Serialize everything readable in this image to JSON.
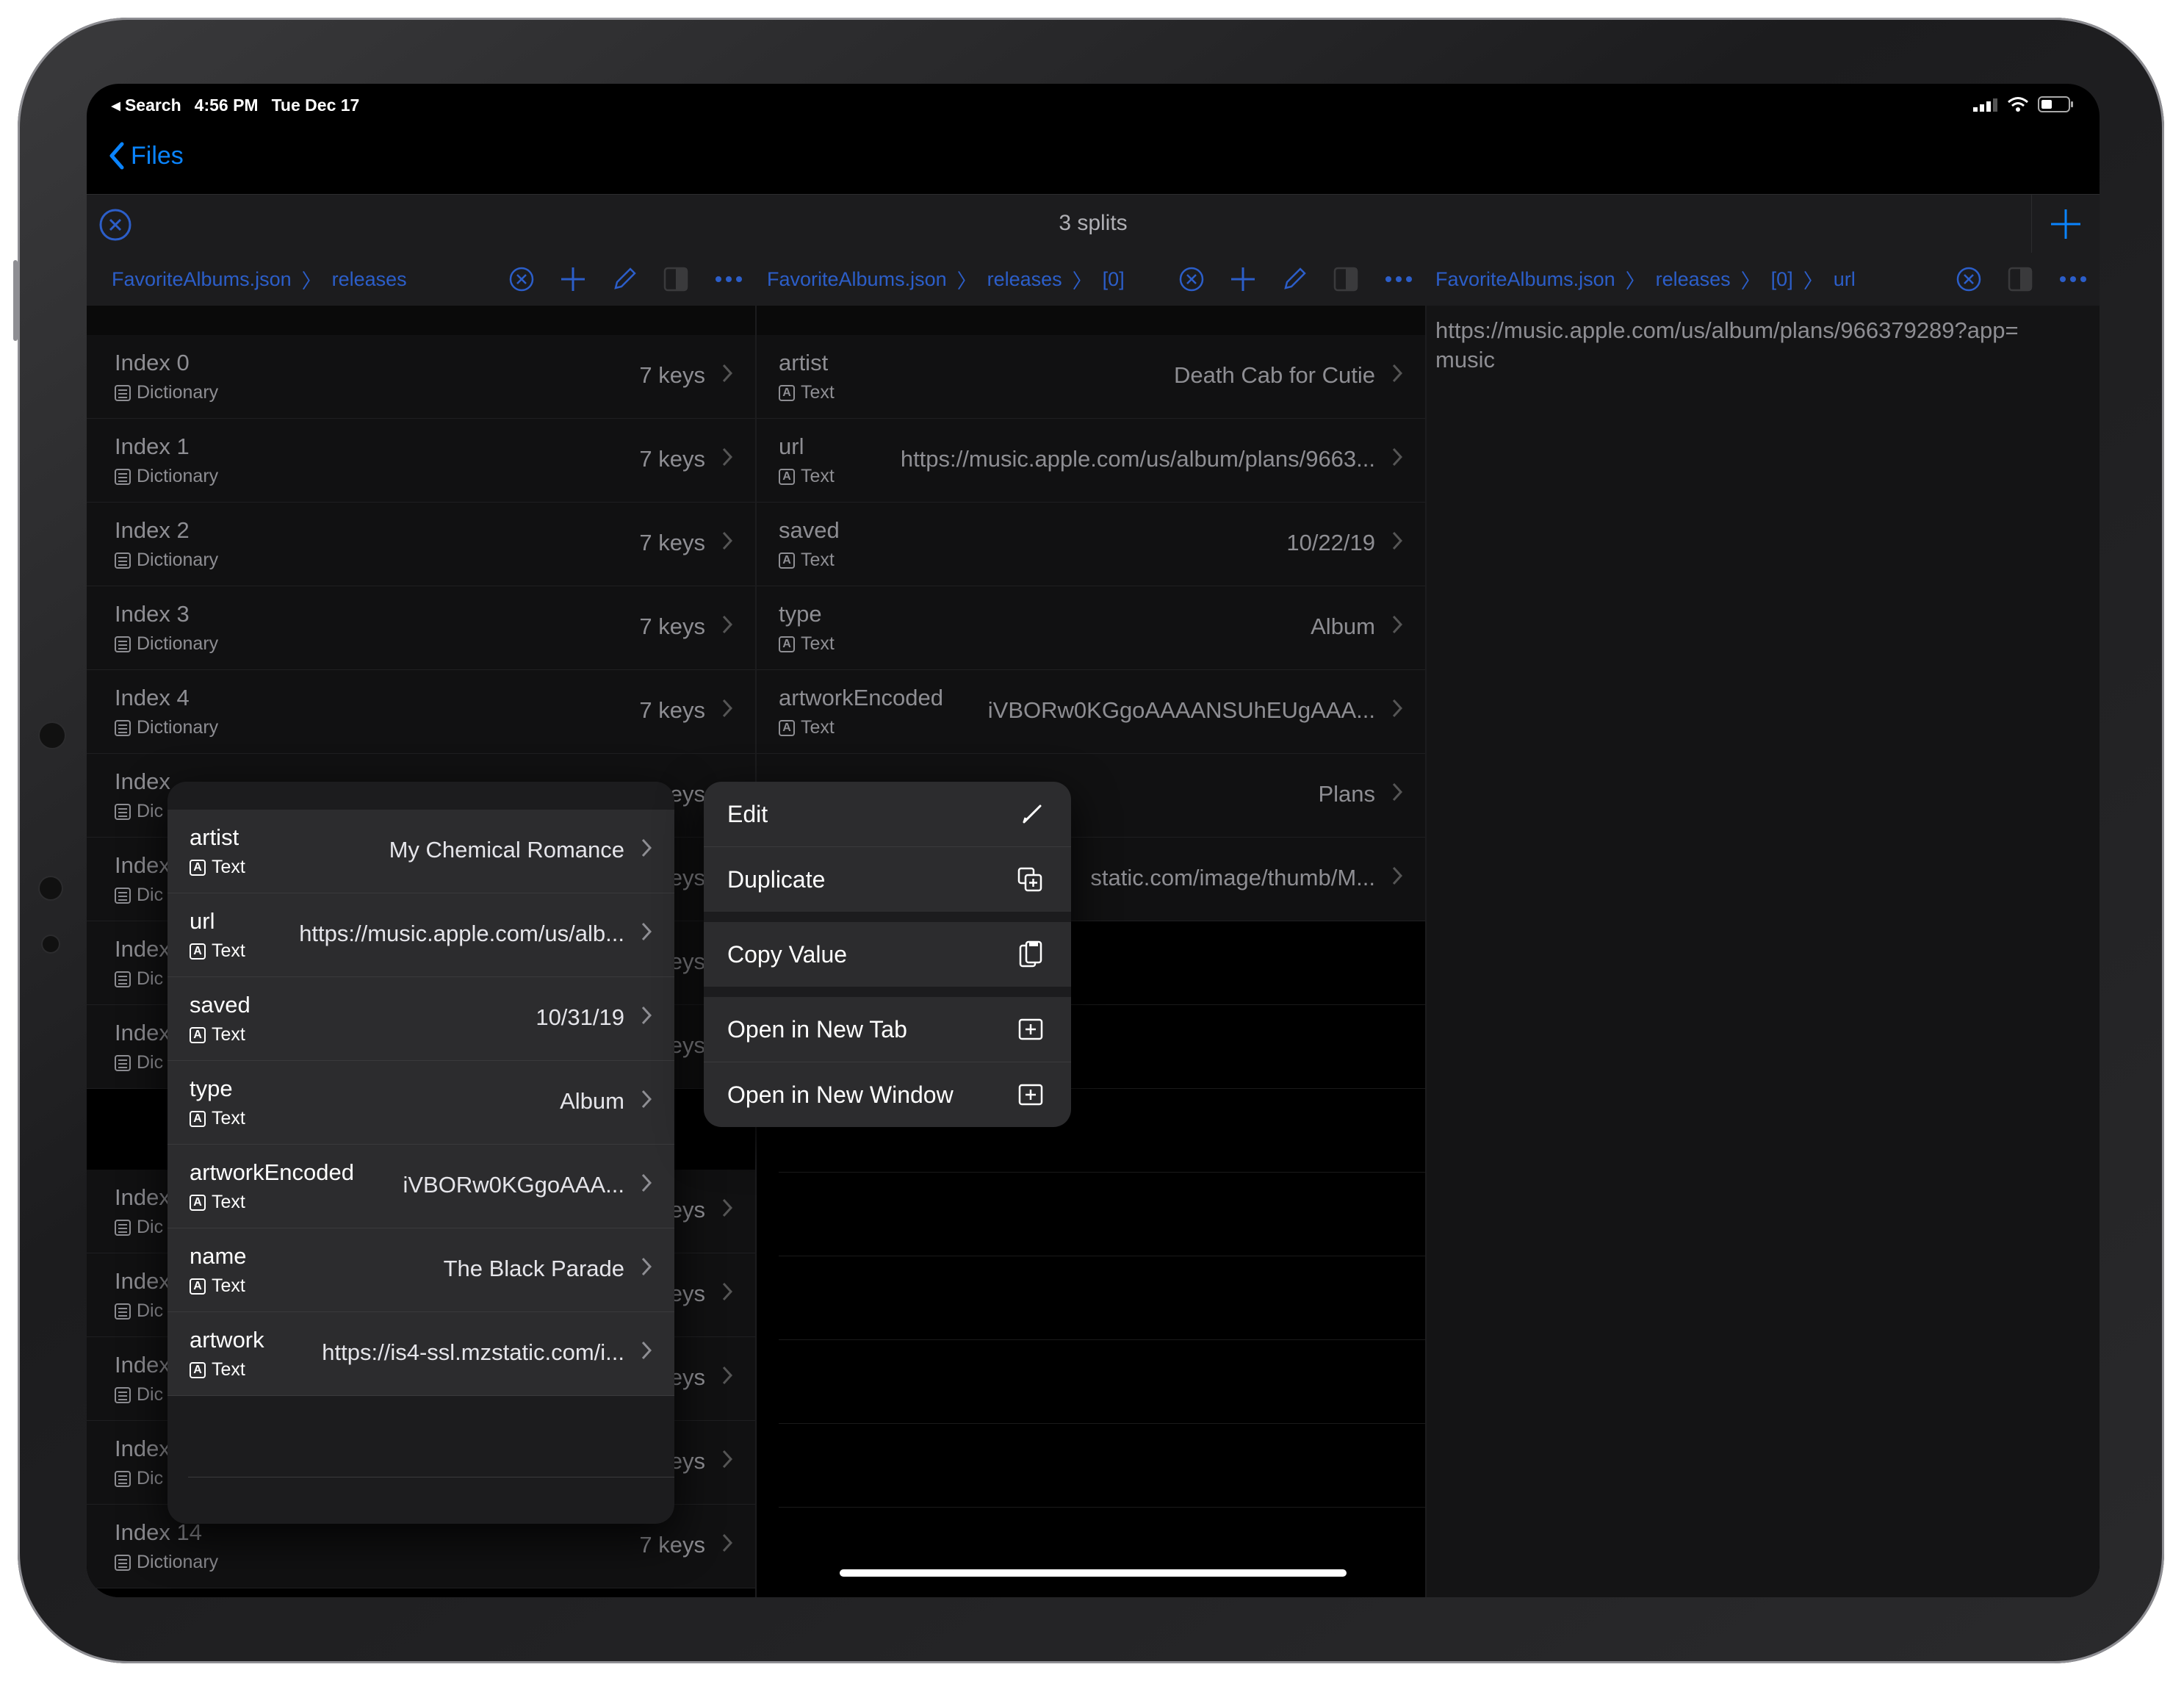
{
  "status": {
    "back_app": "Search",
    "time": "4:56 PM",
    "date": "Tue Dec 17"
  },
  "nav": {
    "back_label": "Files"
  },
  "tabbar": {
    "title": "3 splits"
  },
  "pane1": {
    "crumbs": [
      "FavoriteAlbums.json",
      "releases"
    ],
    "rows_top": [
      {
        "key": "Index 0",
        "type": "Dictionary",
        "value": "7 keys"
      },
      {
        "key": "Index 1",
        "type": "Dictionary",
        "value": "7 keys"
      },
      {
        "key": "Index 2",
        "type": "Dictionary",
        "value": "7 keys"
      },
      {
        "key": "Index 3",
        "type": "Dictionary",
        "value": "7 keys"
      },
      {
        "key": "Index 4",
        "type": "Dictionary",
        "value": "7 keys"
      },
      {
        "key": "Index",
        "type": "Dic",
        "value": "eys"
      },
      {
        "key": "Index",
        "type": "Dic",
        "value": "eys"
      },
      {
        "key": "Index",
        "type": "Dic",
        "value": "eys"
      },
      {
        "key": "Index",
        "type": "Dic",
        "value": "eys"
      }
    ],
    "rows_bottom": [
      {
        "key": "Index",
        "type": "Dic",
        "value": "eys"
      },
      {
        "key": "Index",
        "type": "Dic",
        "value": "eys"
      },
      {
        "key": "Index",
        "type": "Dic",
        "value": "eys"
      },
      {
        "key": "Index",
        "type": "Dic",
        "value": "eys"
      },
      {
        "key": "Index 14",
        "type": "Dictionary",
        "value": "7 keys"
      }
    ]
  },
  "pane2": {
    "crumbs": [
      "FavoriteAlbums.json",
      "releases",
      "[0]"
    ],
    "rows": [
      {
        "key": "artist",
        "type": "Text",
        "value": "Death Cab for Cutie"
      },
      {
        "key": "url",
        "type": "Text",
        "value": "https://music.apple.com/us/album/plans/9663..."
      },
      {
        "key": "saved",
        "type": "Text",
        "value": "10/22/19"
      },
      {
        "key": "type",
        "type": "Text",
        "value": "Album"
      },
      {
        "key": "artworkEncoded",
        "type": "Text",
        "value": "iVBORw0KGgoAAAANSUhEUgAAA..."
      },
      {
        "key": "",
        "type": "",
        "value": "Plans"
      },
      {
        "key": "",
        "type": "",
        "value": "static.com/image/thumb/M..."
      }
    ]
  },
  "pane3": {
    "crumbs": [
      "FavoriteAlbums.json",
      "releases",
      "[0]",
      "url"
    ],
    "value": "https://music.apple.com/us/album/plans/966379289?app=music"
  },
  "preview": {
    "rows": [
      {
        "key": "artist",
        "type": "Text",
        "value": "My Chemical Romance"
      },
      {
        "key": "url",
        "type": "Text",
        "value": "https://music.apple.com/us/alb..."
      },
      {
        "key": "saved",
        "type": "Text",
        "value": "10/31/19"
      },
      {
        "key": "type",
        "type": "Text",
        "value": "Album"
      },
      {
        "key": "artworkEncoded",
        "type": "Text",
        "value": "iVBORw0KGgoAAA..."
      },
      {
        "key": "name",
        "type": "Text",
        "value": "The Black Parade"
      },
      {
        "key": "artwork",
        "type": "Text",
        "value": "https://is4-ssl.mzstatic.com/i..."
      }
    ]
  },
  "menu": {
    "items": [
      {
        "label": "Edit",
        "icon": "pencil-icon"
      },
      {
        "label": "Duplicate",
        "icon": "duplicate-icon"
      },
      {
        "label": "Copy Value",
        "icon": "copy-icon"
      },
      {
        "label": "Open in New Tab",
        "icon": "plus-square-icon"
      },
      {
        "label": "Open in New Window",
        "icon": "plus-square-icon"
      }
    ]
  },
  "colors": {
    "accent": "#0a84ff",
    "crumb": "#2c5ec9",
    "background": "#000000",
    "panel": "#1c1c1e"
  }
}
